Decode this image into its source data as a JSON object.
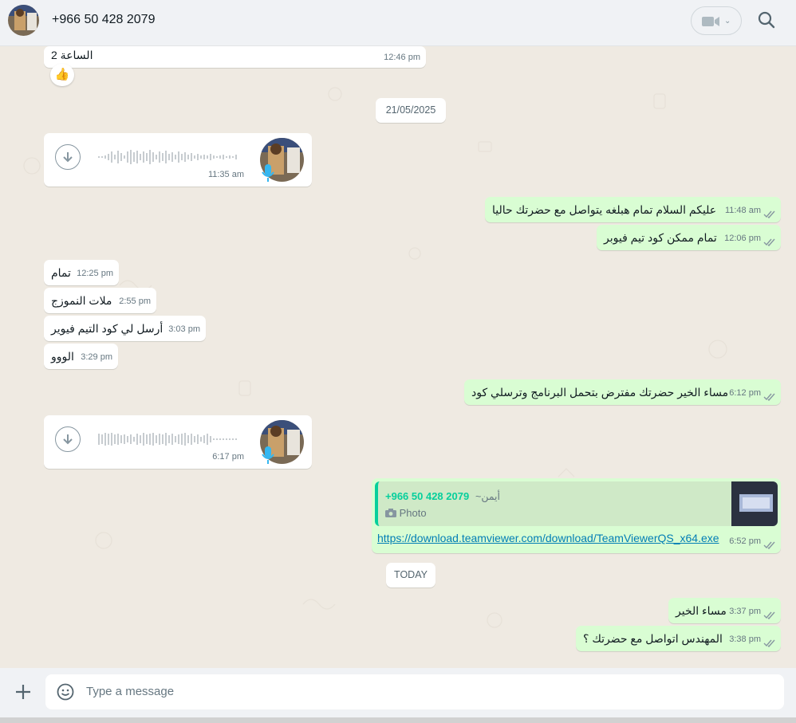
{
  "header": {
    "contact_name": "+966 50 428 2079",
    "icons": [
      "avatar",
      "video-call-icon",
      "chevron-down-icon",
      "search-icon"
    ]
  },
  "colors": {
    "chat_bg": "#efeae2",
    "incoming_bubble": "#ffffff",
    "outgoing_bubble": "#d9fdd3",
    "read_ticks": "#8696a0",
    "link": "#027eb5",
    "accent": "#06cf9c"
  },
  "messages": [
    {
      "dir": "in",
      "type": "text",
      "text": "الساعة 2",
      "time": "12:46 pm",
      "reaction": "👍"
    },
    {
      "type": "date",
      "text": "21/05/2025"
    },
    {
      "dir": "in",
      "type": "voice",
      "time": "11:35 am"
    },
    {
      "dir": "out",
      "type": "text",
      "text": "عليكم السلام تمام هبلغه يتواصل مع حضرتك حاليا",
      "time": "11:48 am"
    },
    {
      "dir": "out",
      "type": "text",
      "text": "تمام ممكن كود تيم فيوبر",
      "time": "12:06 pm"
    },
    {
      "dir": "in",
      "type": "text",
      "text": "تمام",
      "time": "12:25 pm"
    },
    {
      "dir": "in",
      "type": "text",
      "text": "ملات النموزج",
      "time": "2:55 pm"
    },
    {
      "dir": "in",
      "type": "text",
      "text": "أرسل لي كود التيم فيوير",
      "time": "3:03 pm"
    },
    {
      "dir": "in",
      "type": "text",
      "text": "الووو",
      "time": "3:29 pm"
    },
    {
      "dir": "out",
      "type": "text",
      "text": "مساء الخير حضرتك مفترض بتحمل البرنامج وترسلي كود",
      "time": "6:12 pm"
    },
    {
      "dir": "in",
      "type": "voice",
      "time": "6:17 pm"
    },
    {
      "dir": "out",
      "type": "reply_link",
      "quote": {
        "name": "+966 50 428 2079",
        "alias": "~أيمن",
        "media": "Photo"
      },
      "link": "https://download.teamviewer.com/download/TeamViewerQS_x64.exe",
      "time": "6:52 pm"
    },
    {
      "type": "date",
      "text": "TODAY"
    },
    {
      "dir": "out",
      "type": "text",
      "text": "مساء الخير",
      "time": "3:37 pm"
    },
    {
      "dir": "out",
      "type": "text",
      "text": "المهندس اتواصل مع حضرتك ؟",
      "time": "3:38 pm"
    }
  ],
  "composer": {
    "placeholder": "Type a message",
    "icons": [
      "plus-icon",
      "sticker-icon"
    ]
  }
}
